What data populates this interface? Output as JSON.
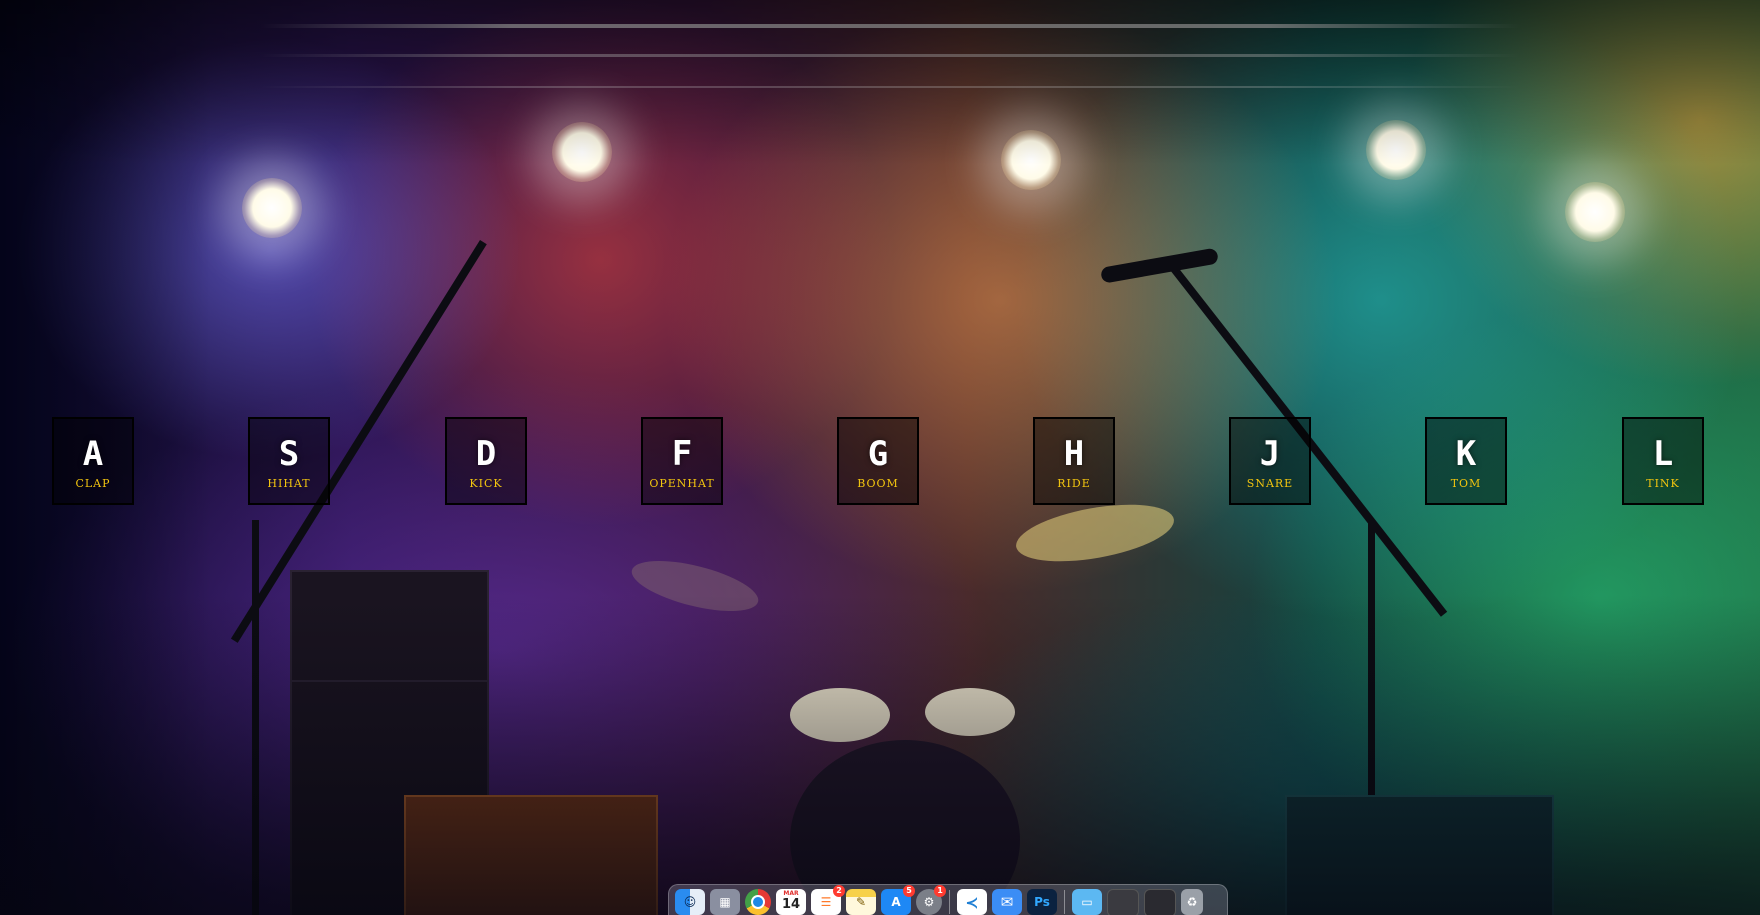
{
  "drum_keys": [
    {
      "letter": "A",
      "sound": "clap"
    },
    {
      "letter": "S",
      "sound": "hihat"
    },
    {
      "letter": "D",
      "sound": "kick"
    },
    {
      "letter": "F",
      "sound": "openhat"
    },
    {
      "letter": "G",
      "sound": "boom"
    },
    {
      "letter": "H",
      "sound": "ride"
    },
    {
      "letter": "J",
      "sound": "snare"
    },
    {
      "letter": "K",
      "sound": "tom"
    },
    {
      "letter": "L",
      "sound": "tink"
    }
  ],
  "colors": {
    "key_letter": "#ffffff",
    "key_sound": "#f1c40f",
    "key_border": "#000000"
  },
  "dock": {
    "apps": [
      {
        "icon": "finder-icon",
        "glyph": "☺",
        "color": "#2a8cf0"
      },
      {
        "icon": "launchpad-icon",
        "glyph": "▦",
        "color": "#8a8fa0"
      },
      {
        "icon": "chrome-icon",
        "glyph": "●",
        "color": "#e8e8e8"
      },
      {
        "icon": "calendar-icon",
        "glyph": "",
        "color": "#ffffff",
        "month": "MAR",
        "day": "14"
      },
      {
        "icon": "reminders-icon",
        "glyph": "☰",
        "color": "#ffffff",
        "badge": "2"
      },
      {
        "icon": "notes-icon",
        "glyph": "✎",
        "color": "#f7d14a"
      },
      {
        "icon": "app-store-icon",
        "glyph": "A",
        "color": "#1e88f5",
        "badge": "5"
      },
      {
        "icon": "system-settings-icon",
        "glyph": "⚙",
        "color": "#7b7f88",
        "badge": "1"
      }
    ],
    "dev_apps": [
      {
        "icon": "vscode-icon",
        "glyph": "≺",
        "color": "#1f7fd4"
      },
      {
        "icon": "mail-icon",
        "glyph": "✉",
        "color": "#3b8df5"
      },
      {
        "icon": "photoshop-icon",
        "glyph": "Ps",
        "color": "#0b2240"
      }
    ],
    "docs": [
      {
        "icon": "folder-icon",
        "glyph": "▭",
        "color": "#5cb8f2"
      },
      {
        "icon": "window-thumbnail-icon",
        "glyph": "",
        "color": "#3a3a40"
      },
      {
        "icon": "window-thumbnail-icon",
        "glyph": "",
        "color": "#2a2a30"
      },
      {
        "icon": "trash-icon",
        "glyph": "♻",
        "color": "#9aa0a8"
      }
    ]
  }
}
